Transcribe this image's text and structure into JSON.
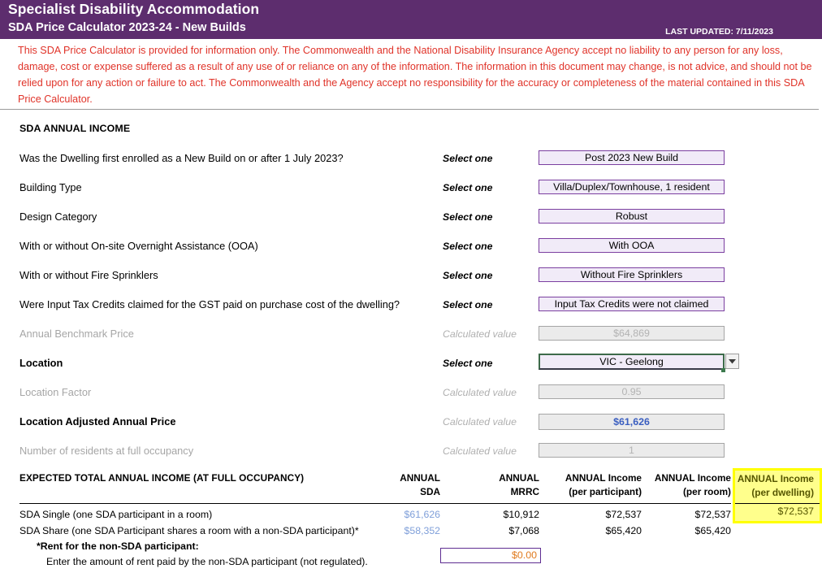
{
  "banner": {
    "title": "Specialist Disability Accommodation",
    "subtitle": "SDA Price Calculator 2023-24 - New Builds",
    "last_updated": "LAST UPDATED: 7/11/2023",
    "bg_color": "#5d2d6e"
  },
  "disclaimer": {
    "text": "This SDA Price Calculator is provided for information only.  The Commonwealth and the National Disability Insurance Agency accept no liability to any person for any loss, damage, cost or expense suffered as a result of any use of or reliance on any of the information.  The information in this document may change, is not advice, and should not be relied upon for any action or failure to act. The Commonwealth and the Agency accept no responsibility for the accuracy or completeness of the material contained in this SDA Price Calculator.",
    "color": "#e03329"
  },
  "section": {
    "title": "SDA ANNUAL INCOME"
  },
  "form": {
    "hint_select": "Select one",
    "hint_calc": "Calculated value",
    "rows": [
      {
        "label": "Was the Dwelling first enrolled as a New Build on or after 1 July 2023?",
        "hint": "Select one",
        "value": "Post 2023 New Build",
        "kind": "select"
      },
      {
        "label": "Building Type",
        "hint": "Select one",
        "value": "Villa/Duplex/Townhouse, 1 resident",
        "kind": "select"
      },
      {
        "label": "Design Category",
        "hint": "Select one",
        "value": "Robust",
        "kind": "select"
      },
      {
        "label": "With or without On-site Overnight Assistance (OOA)",
        "hint": "Select one",
        "value": "With OOA",
        "kind": "select"
      },
      {
        "label": "With or without Fire Sprinklers",
        "hint": "Select one",
        "value": "Without Fire Sprinklers",
        "kind": "select"
      },
      {
        "label": "Were Input Tax Credits claimed for the GST paid on purchase cost of the dwelling?",
        "hint": "Select one",
        "value": "Input Tax Credits were not claimed",
        "kind": "select"
      },
      {
        "label": "Annual Benchmark Price",
        "hint": "Calculated value",
        "value": "$64,869",
        "kind": "calc"
      },
      {
        "label": "Location",
        "hint": "Select one",
        "value": "VIC - Geelong",
        "kind": "selected-dropdown"
      },
      {
        "label": "Location Factor",
        "hint": "Calculated value",
        "value": "0.95",
        "kind": "calc"
      },
      {
        "label": "Location Adjusted Annual Price",
        "hint": "Calculated value",
        "value": "$61,626",
        "kind": "calc-strong"
      },
      {
        "label": "Number of residents at full occupancy",
        "hint": "Calculated value",
        "value": "1",
        "kind": "calc"
      }
    ]
  },
  "table": {
    "title": "EXPECTED TOTAL ANNUAL INCOME (AT FULL OCCUPANCY)",
    "columns": [
      {
        "line1": "ANNUAL",
        "line2": "SDA"
      },
      {
        "line1": "ANNUAL",
        "line2": "MRRC"
      },
      {
        "line1": "ANNUAL Income",
        "line2": "(per participant)"
      },
      {
        "line1": "ANNUAL Income",
        "line2": "(per room)"
      },
      {
        "line1": "ANNUAL Income",
        "line2": "(per dwelling)"
      }
    ],
    "rows": [
      {
        "label": "SDA Single (one SDA participant in a room)",
        "annual_sda": "$61,626",
        "annual_mrrc": "$10,912",
        "per_participant": "$72,537",
        "per_room": "$72,537",
        "per_dwelling": "$72,537"
      },
      {
        "label": "SDA Share (one SDA Participant shares a room with a non-SDA participant)*",
        "annual_sda": "$58,352",
        "annual_mrrc": "$7,068",
        "per_participant": "$65,420",
        "per_room": "$65,420",
        "per_dwelling": ""
      }
    ],
    "highlight_color": "#ffff00"
  },
  "rent": {
    "heading": "*Rent for the non-SDA participant:",
    "description": "Enter the amount of rent paid by the non-SDA participant (not regulated).",
    "value": "$0.00",
    "placeholder": "$0.00"
  },
  "icons": {
    "dropdown": "chevron-down-icon"
  }
}
